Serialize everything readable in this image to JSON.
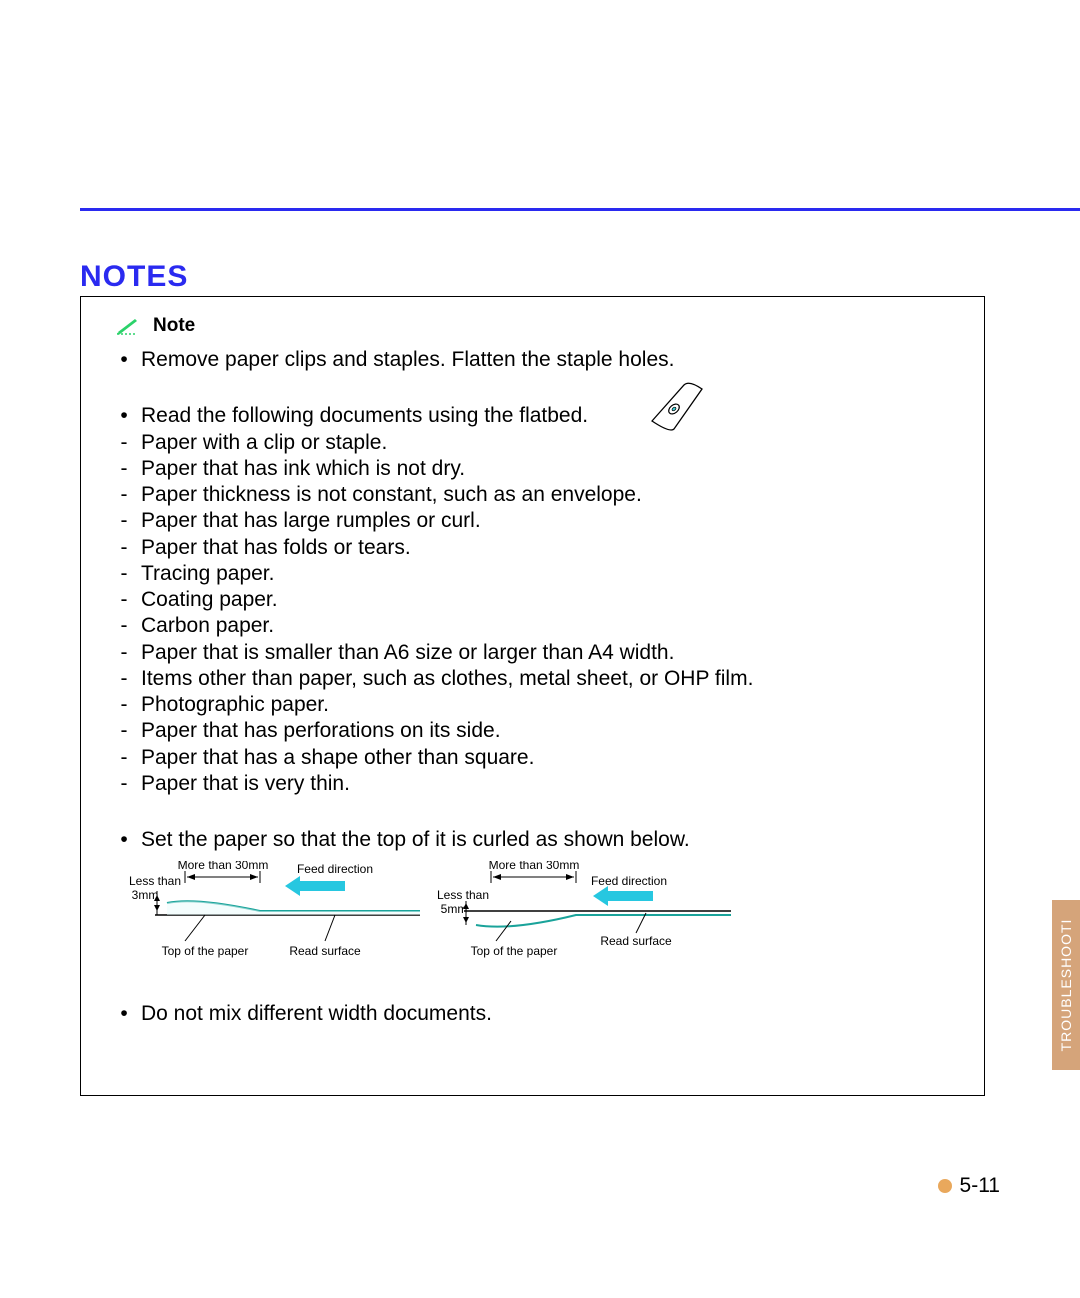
{
  "section_title": "NOTES",
  "note_label": "Note",
  "side_tab": "TROUBLESHOOTI",
  "page_number": "5-11",
  "bullets": {
    "b1": "Remove paper clips and staples.  Flatten the staple holes.",
    "b2": "Read the following documents using the flatbed.",
    "b3": "Set the paper so that the top of it is curled as shown below.",
    "b4": "Do not mix different width documents."
  },
  "flatbed_list": [
    "Paper with a clip or staple.",
    "Paper that has ink which is not dry.",
    "Paper thickness is not constant, such as an envelope.",
    "Paper that has large rumples or curl.",
    "Paper that has folds or tears.",
    "Tracing paper.",
    "Coating paper.",
    "Carbon paper.",
    "Paper that is smaller than A6 size or larger than A4 width.",
    "Items other than paper, such as clothes, metal sheet, or OHP film.",
    "Photographic paper.",
    "Paper that has perforations on its side.",
    "Paper that has a shape other than square.",
    "Paper that is very thin."
  ],
  "diagram1": {
    "more_than": "More than 30mm",
    "less_than_label": "Less than",
    "less_than_value": "3mm",
    "feed": "Feed direction",
    "top": "Top of the paper",
    "read": "Read surface"
  },
  "diagram2": {
    "more_than": "More than 30mm",
    "less_than_label": "Less than",
    "less_than_value": "5mm",
    "feed": "Feed direction",
    "top": "Top of the paper",
    "read": "Read surface"
  }
}
